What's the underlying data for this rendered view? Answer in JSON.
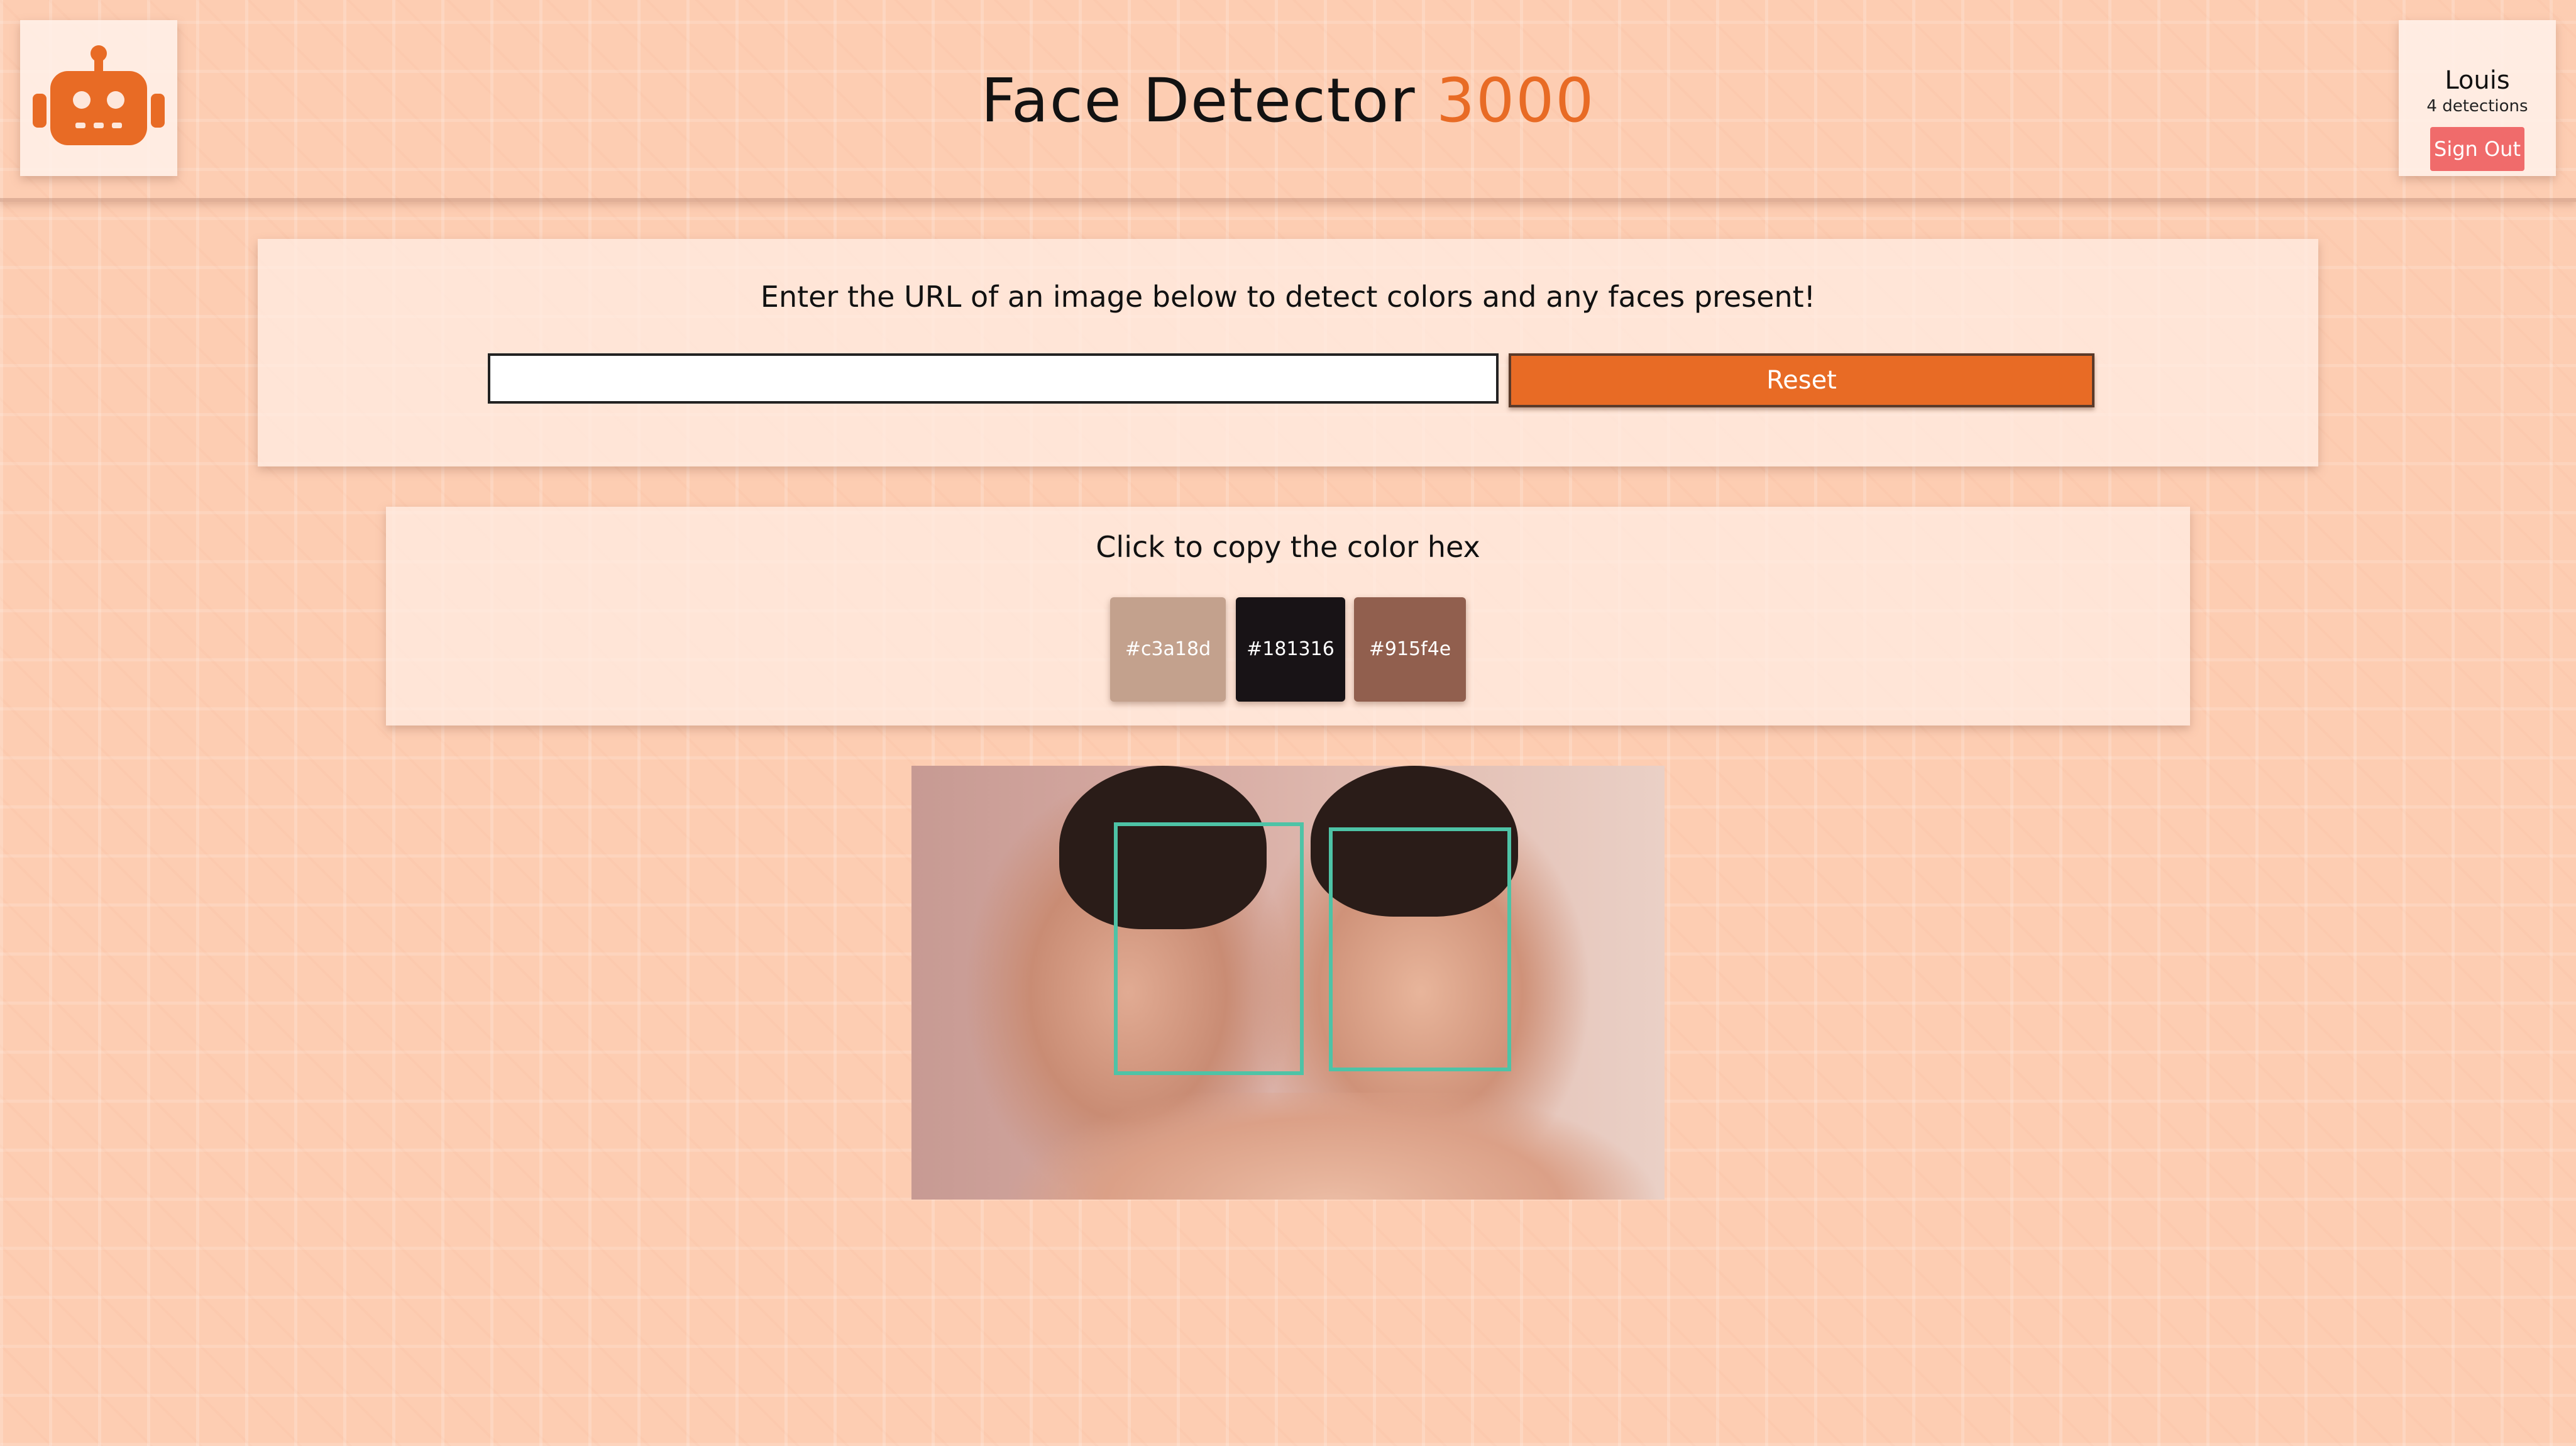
{
  "header": {
    "title_main": "Face Detector",
    "title_accent": "3000",
    "logo_icon": "robot-icon",
    "accent_color": "#e86b25"
  },
  "user": {
    "name": "Louis",
    "stats": "4 detections",
    "signout_label": "Sign Out"
  },
  "url_form": {
    "instructions": "Enter the URL of an image below to detect colors and any faces present!",
    "input_value": "",
    "input_placeholder": "",
    "reset_label": "Reset"
  },
  "palette": {
    "title": "Click to copy the color hex",
    "swatches": [
      {
        "hex": "#c3a18d",
        "label": "#c3a18d"
      },
      {
        "hex": "#181316",
        "label": "#181316"
      },
      {
        "hex": "#915f4e",
        "label": "#915f4e"
      }
    ]
  },
  "result": {
    "face_count": 2,
    "box_color": "#4ec3a6"
  }
}
